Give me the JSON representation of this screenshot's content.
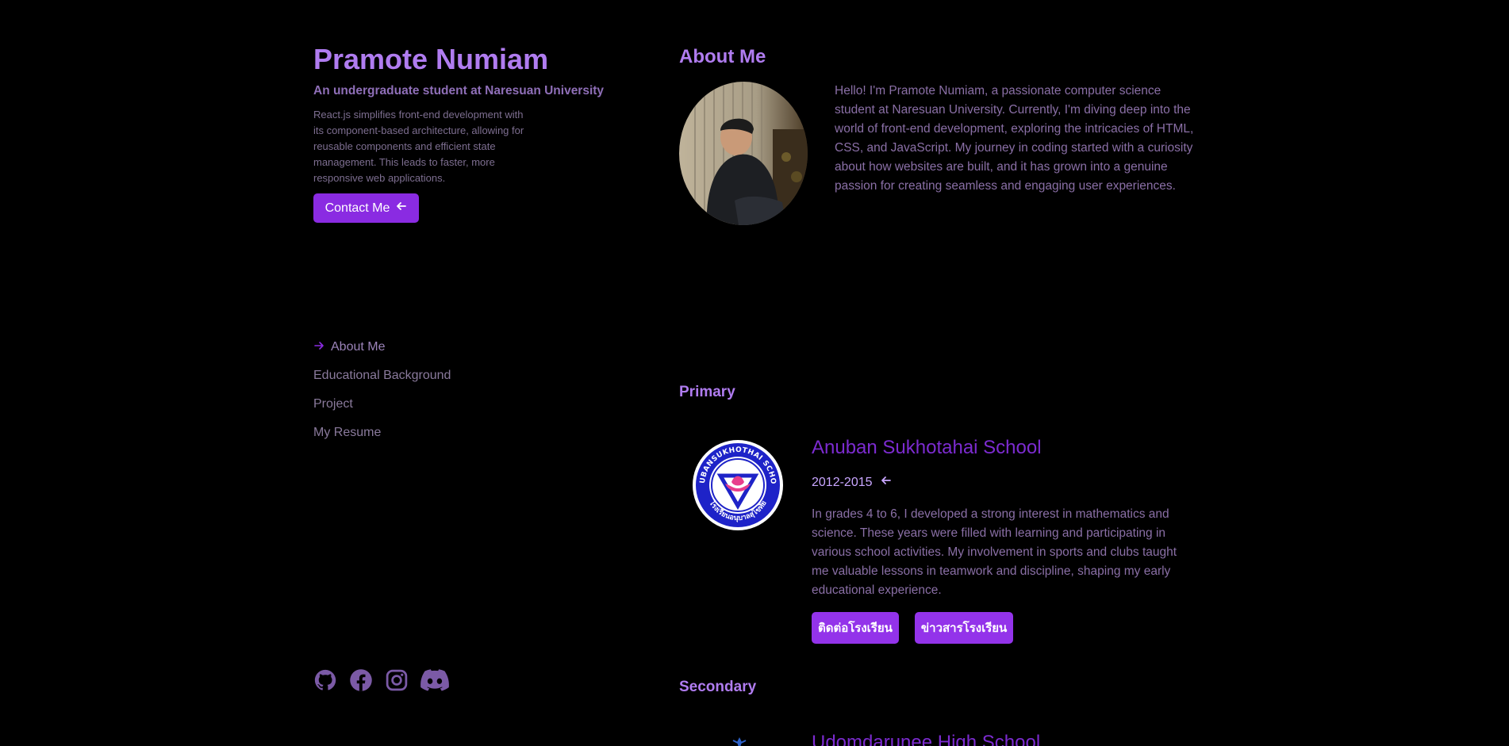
{
  "profile": {
    "name": "Pramote Numiam",
    "subtitle": "An undergraduate student at Naresuan University",
    "blurb": "React.js simplifies front-end development with its component-based architecture, allowing for reusable components and efficient state management. This leads to faster, more responsive web applications.",
    "contact_label": "Contact Me"
  },
  "nav": {
    "items": [
      {
        "label": "About Me",
        "active": true
      },
      {
        "label": "Educational Background",
        "active": false
      },
      {
        "label": "Project",
        "active": false
      },
      {
        "label": "My Resume",
        "active": false
      }
    ]
  },
  "socials": [
    "github-icon",
    "facebook-icon",
    "instagram-icon",
    "discord-icon"
  ],
  "about": {
    "title": "About Me",
    "text": "Hello! I'm Pramote Numiam, a passionate computer science student at Naresuan University. Currently, I'm diving deep into the world of front-end development, exploring the intricacies of HTML, CSS, and JavaScript. My journey in coding started with a curiosity about how websites are built, and it has grown into a genuine passion for creating seamless and engaging user experiences."
  },
  "education": {
    "primary_title": "Primary",
    "secondary_title": "Secondary",
    "primary": {
      "name": "Anuban Sukhotahai School",
      "years": "2012-2015",
      "description": "In grades 4 to 6, I developed a strong interest in mathematics and science. These years were filled with learning and participating in various school activities. My involvement in sports and clubs taught me valuable lessons in teamwork and discipline, shaping my early educational experience.",
      "buttons": [
        "ติดต่อโรงเรียน",
        "ข่าวสารโรงเรียน"
      ],
      "logo_text_top": "ANUBANSUKHOTHAI SCHOOL",
      "logo_text_bottom": "โรงเรียนอนุบาลสุโขทัย"
    },
    "secondary": {
      "name": "Udomdarunee High School"
    }
  },
  "colors": {
    "accent": "#8a2be2",
    "heading": "#b07cf0",
    "school_name": "#7c2bd0",
    "background": "#000000"
  }
}
